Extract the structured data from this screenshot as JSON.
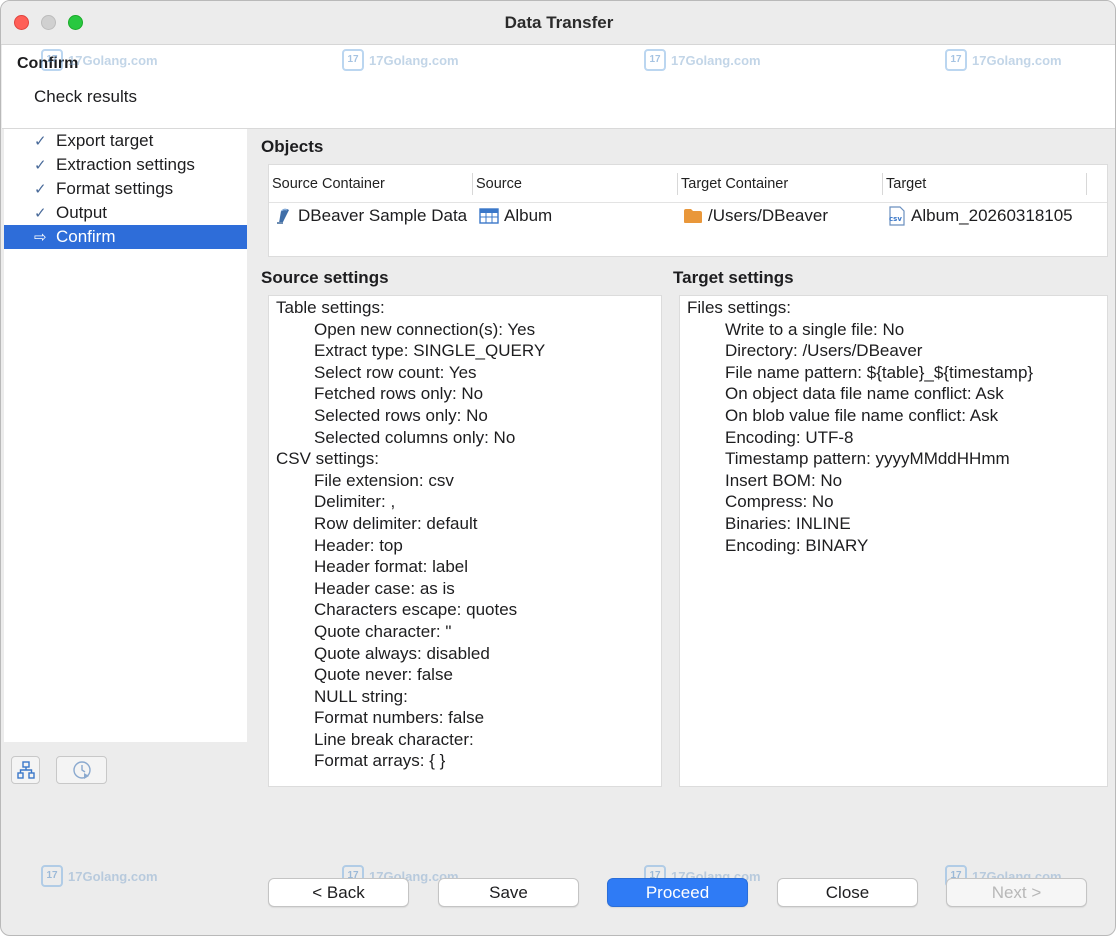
{
  "window": {
    "title": "Data Transfer"
  },
  "header": {
    "title": "Confirm",
    "subtitle": "Check results"
  },
  "watermark": {
    "text": "17Golang.com",
    "badge": "17"
  },
  "nav": {
    "items": [
      {
        "label": "Export target",
        "state": "done"
      },
      {
        "label": "Extraction settings",
        "state": "done"
      },
      {
        "label": "Format settings",
        "state": "done"
      },
      {
        "label": "Output",
        "state": "done"
      },
      {
        "label": "Confirm",
        "state": "active"
      }
    ]
  },
  "objects": {
    "label": "Objects",
    "columns": [
      "Source Container",
      "Source",
      "Target Container",
      "Target"
    ],
    "rows": [
      {
        "source_container": "DBeaver Sample Data",
        "source": "Album",
        "target_container": "/Users/DBeaver",
        "target": "Album_20260318105"
      }
    ]
  },
  "source_settings": {
    "label": "Source settings",
    "groups": [
      {
        "title": "Table settings:",
        "lines": [
          "Open new connection(s): Yes",
          "Extract type: SINGLE_QUERY",
          "Select row count: Yes",
          "Fetched rows only: No",
          "Selected rows only: No",
          "Selected columns only: No"
        ]
      },
      {
        "title": "CSV settings:",
        "lines": [
          "File extension: csv",
          "Delimiter: ,",
          "Row delimiter: default",
          "Header: top",
          "Header format: label",
          "Header case: as is",
          "Characters escape: quotes",
          "Quote character: \"",
          "Quote always: disabled",
          "Quote never: false",
          "NULL string:",
          "Format numbers: false",
          "Line break character:",
          "Format arrays: { }"
        ]
      }
    ]
  },
  "target_settings": {
    "label": "Target settings",
    "groups": [
      {
        "title": "Files settings:",
        "lines": [
          "Write to a single file: No",
          "Directory: /Users/DBeaver",
          "File name pattern: ${table}_${timestamp}",
          "On object data file name conflict: Ask",
          "On blob value file name conflict: Ask",
          "Encoding: UTF-8",
          "Timestamp pattern: yyyyMMddHHmm",
          "Insert BOM: No",
          "Compress: No",
          "Binaries: INLINE",
          "Encoding: BINARY"
        ]
      }
    ]
  },
  "buttons": {
    "back": "< Back",
    "save": "Save",
    "proceed": "Proceed",
    "close": "Close",
    "next": "Next >"
  },
  "colors": {
    "accent": "#2e6dd9",
    "primary_button": "#2f7bf5",
    "folder": "#e9973a"
  }
}
